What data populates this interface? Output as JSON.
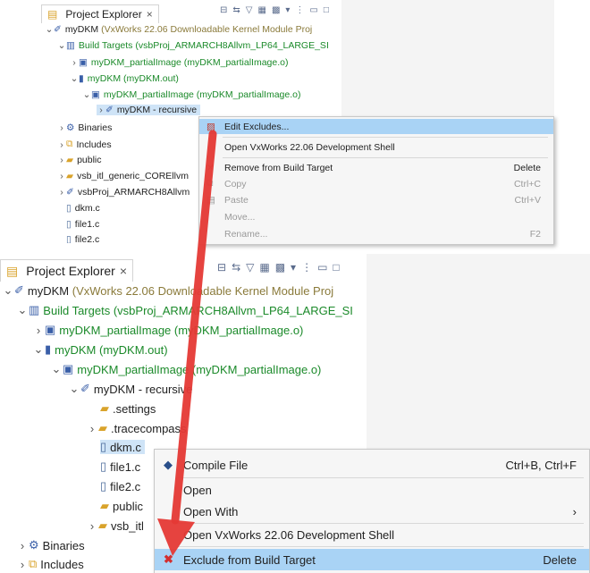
{
  "top": {
    "tab_label": "Project Explorer",
    "close_glyph": "×",
    "tree": [
      {
        "text": "myDKM",
        "suffix": "(VxWorks 22.06 Downloadable Kernel Module Proj",
        "icon": "project-icon"
      },
      {
        "text": "Build Targets",
        "suffix": "(vsbProj_ARMARCH8Allvm_LP64_LARGE_SI",
        "icon": "build-targets-icon"
      },
      {
        "text": "myDKM_partialImage (myDKM_partialImage.o)",
        "icon": "build-target-icon"
      },
      {
        "text": "myDKM (myDKM.out)",
        "icon": "build-target-icon"
      },
      {
        "text": "myDKM_partialImage (myDKM_partialImage.o)",
        "icon": "build-target-icon"
      },
      {
        "text": "myDKM - recursive",
        "icon": "recursive-folder-icon"
      },
      {
        "text": "Binaries",
        "icon": "binaries-icon"
      },
      {
        "text": "Includes",
        "icon": "includes-icon"
      },
      {
        "text": "public",
        "icon": "folder-icon"
      },
      {
        "text": "vsb_itl_generic_COREllvm",
        "icon": "folder-icon"
      },
      {
        "text": "vsbProj_ARMARCH8Allvm",
        "icon": "project-icon"
      },
      {
        "text": "dkm.c",
        "icon": "c-file-icon"
      },
      {
        "text": "file1.c",
        "icon": "c-file-icon"
      },
      {
        "text": "file2.c",
        "icon": "c-file-icon"
      }
    ],
    "menu": [
      {
        "label": "Edit Excludes...",
        "shortcut": "",
        "icon": "edit-excludes-icon"
      },
      {
        "label": "Open VxWorks 22.06 Development Shell",
        "shortcut": ""
      },
      {
        "label": "Remove from Build Target",
        "shortcut": "Delete",
        "icon": "remove-icon"
      },
      {
        "label": "Copy",
        "shortcut": "Ctrl+C",
        "icon": "copy-icon"
      },
      {
        "label": "Paste",
        "shortcut": "Ctrl+V",
        "icon": "paste-icon"
      },
      {
        "label": "Move...",
        "shortcut": ""
      },
      {
        "label": "Rename...",
        "shortcut": "F2"
      }
    ]
  },
  "bottom": {
    "tab_label": "Project Explorer",
    "close_glyph": "×",
    "tree": [
      {
        "text": "myDKM",
        "suffix": "(VxWorks 22.06 Downloadable Kernel Module Proj",
        "icon": "project-icon"
      },
      {
        "text": "Build Targets",
        "suffix": "(vsbProj_ARMARCH8Allvm_LP64_LARGE_SI",
        "icon": "build-targets-icon"
      },
      {
        "text": "myDKM_partialImage (myDKM_partialImage.o)",
        "icon": "build-target-icon"
      },
      {
        "text": "myDKM (myDKM.out)",
        "icon": "build-target-icon"
      },
      {
        "text": "myDKM_partialImage (myDKM_partialImage.o)",
        "icon": "build-target-icon"
      },
      {
        "text": "myDKM - recursive",
        "icon": "recursive-folder-icon"
      },
      {
        "text": ".settings",
        "icon": "folder-icon"
      },
      {
        "text": ".tracecompass",
        "icon": "folder-icon"
      },
      {
        "text": "dkm.c",
        "icon": "c-file-icon"
      },
      {
        "text": "file1.c",
        "icon": "c-file-icon"
      },
      {
        "text": "file2.c",
        "icon": "c-file-icon"
      },
      {
        "text": "public",
        "icon": "folder-icon"
      },
      {
        "text": "vsb_itl",
        "icon": "folder-icon"
      },
      {
        "text": "Binaries",
        "icon": "binaries-icon"
      },
      {
        "text": "Includes",
        "icon": "includes-icon"
      }
    ],
    "menu": [
      {
        "label": "Compile File",
        "shortcut": "Ctrl+B, Ctrl+F",
        "icon": "compile-icon"
      },
      {
        "label": "Open",
        "shortcut": ""
      },
      {
        "label": "Open With",
        "shortcut": "›"
      },
      {
        "label": "Open VxWorks 22.06 Development Shell",
        "shortcut": ""
      },
      {
        "label": "Exclude from Build Target",
        "shortcut": "Delete",
        "icon": "exclude-icon"
      }
    ]
  },
  "colors": {
    "arrow": "#e53935",
    "highlight": "#a9d3f5",
    "selection": "#cfe4f7",
    "green": "#1b8a2a",
    "olive": "#8a7a3a"
  }
}
